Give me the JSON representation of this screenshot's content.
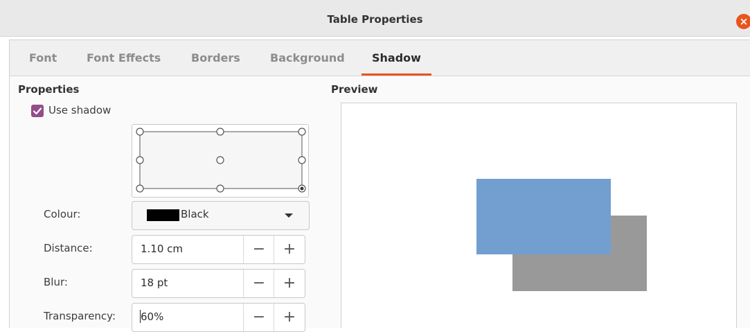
{
  "window": {
    "title": "Table Properties",
    "close_icon": "close-icon"
  },
  "tabs": [
    {
      "label": "Font",
      "active": false
    },
    {
      "label": "Font Effects",
      "active": false
    },
    {
      "label": "Borders",
      "active": false
    },
    {
      "label": "Background",
      "active": false
    },
    {
      "label": "Shadow",
      "active": true
    }
  ],
  "properties": {
    "heading": "Properties",
    "use_shadow": {
      "label": "Use shadow",
      "checked": true
    },
    "position_selected": "bottom-right",
    "colour": {
      "label": "Colour:",
      "value": "Black",
      "swatch": "#000000"
    },
    "distance": {
      "label": "Distance:",
      "value": "1.10 cm"
    },
    "blur": {
      "label": "Blur:",
      "value": "18 pt"
    },
    "transparency": {
      "label": "Transparency:",
      "value": "60%"
    },
    "minus_symbol": "−",
    "plus_symbol": "+"
  },
  "preview": {
    "heading": "Preview",
    "object_color": "#729fcf",
    "shadow_color": "#999999"
  },
  "colors": {
    "accent": "#e95420",
    "checkbox": "#924d8b"
  }
}
